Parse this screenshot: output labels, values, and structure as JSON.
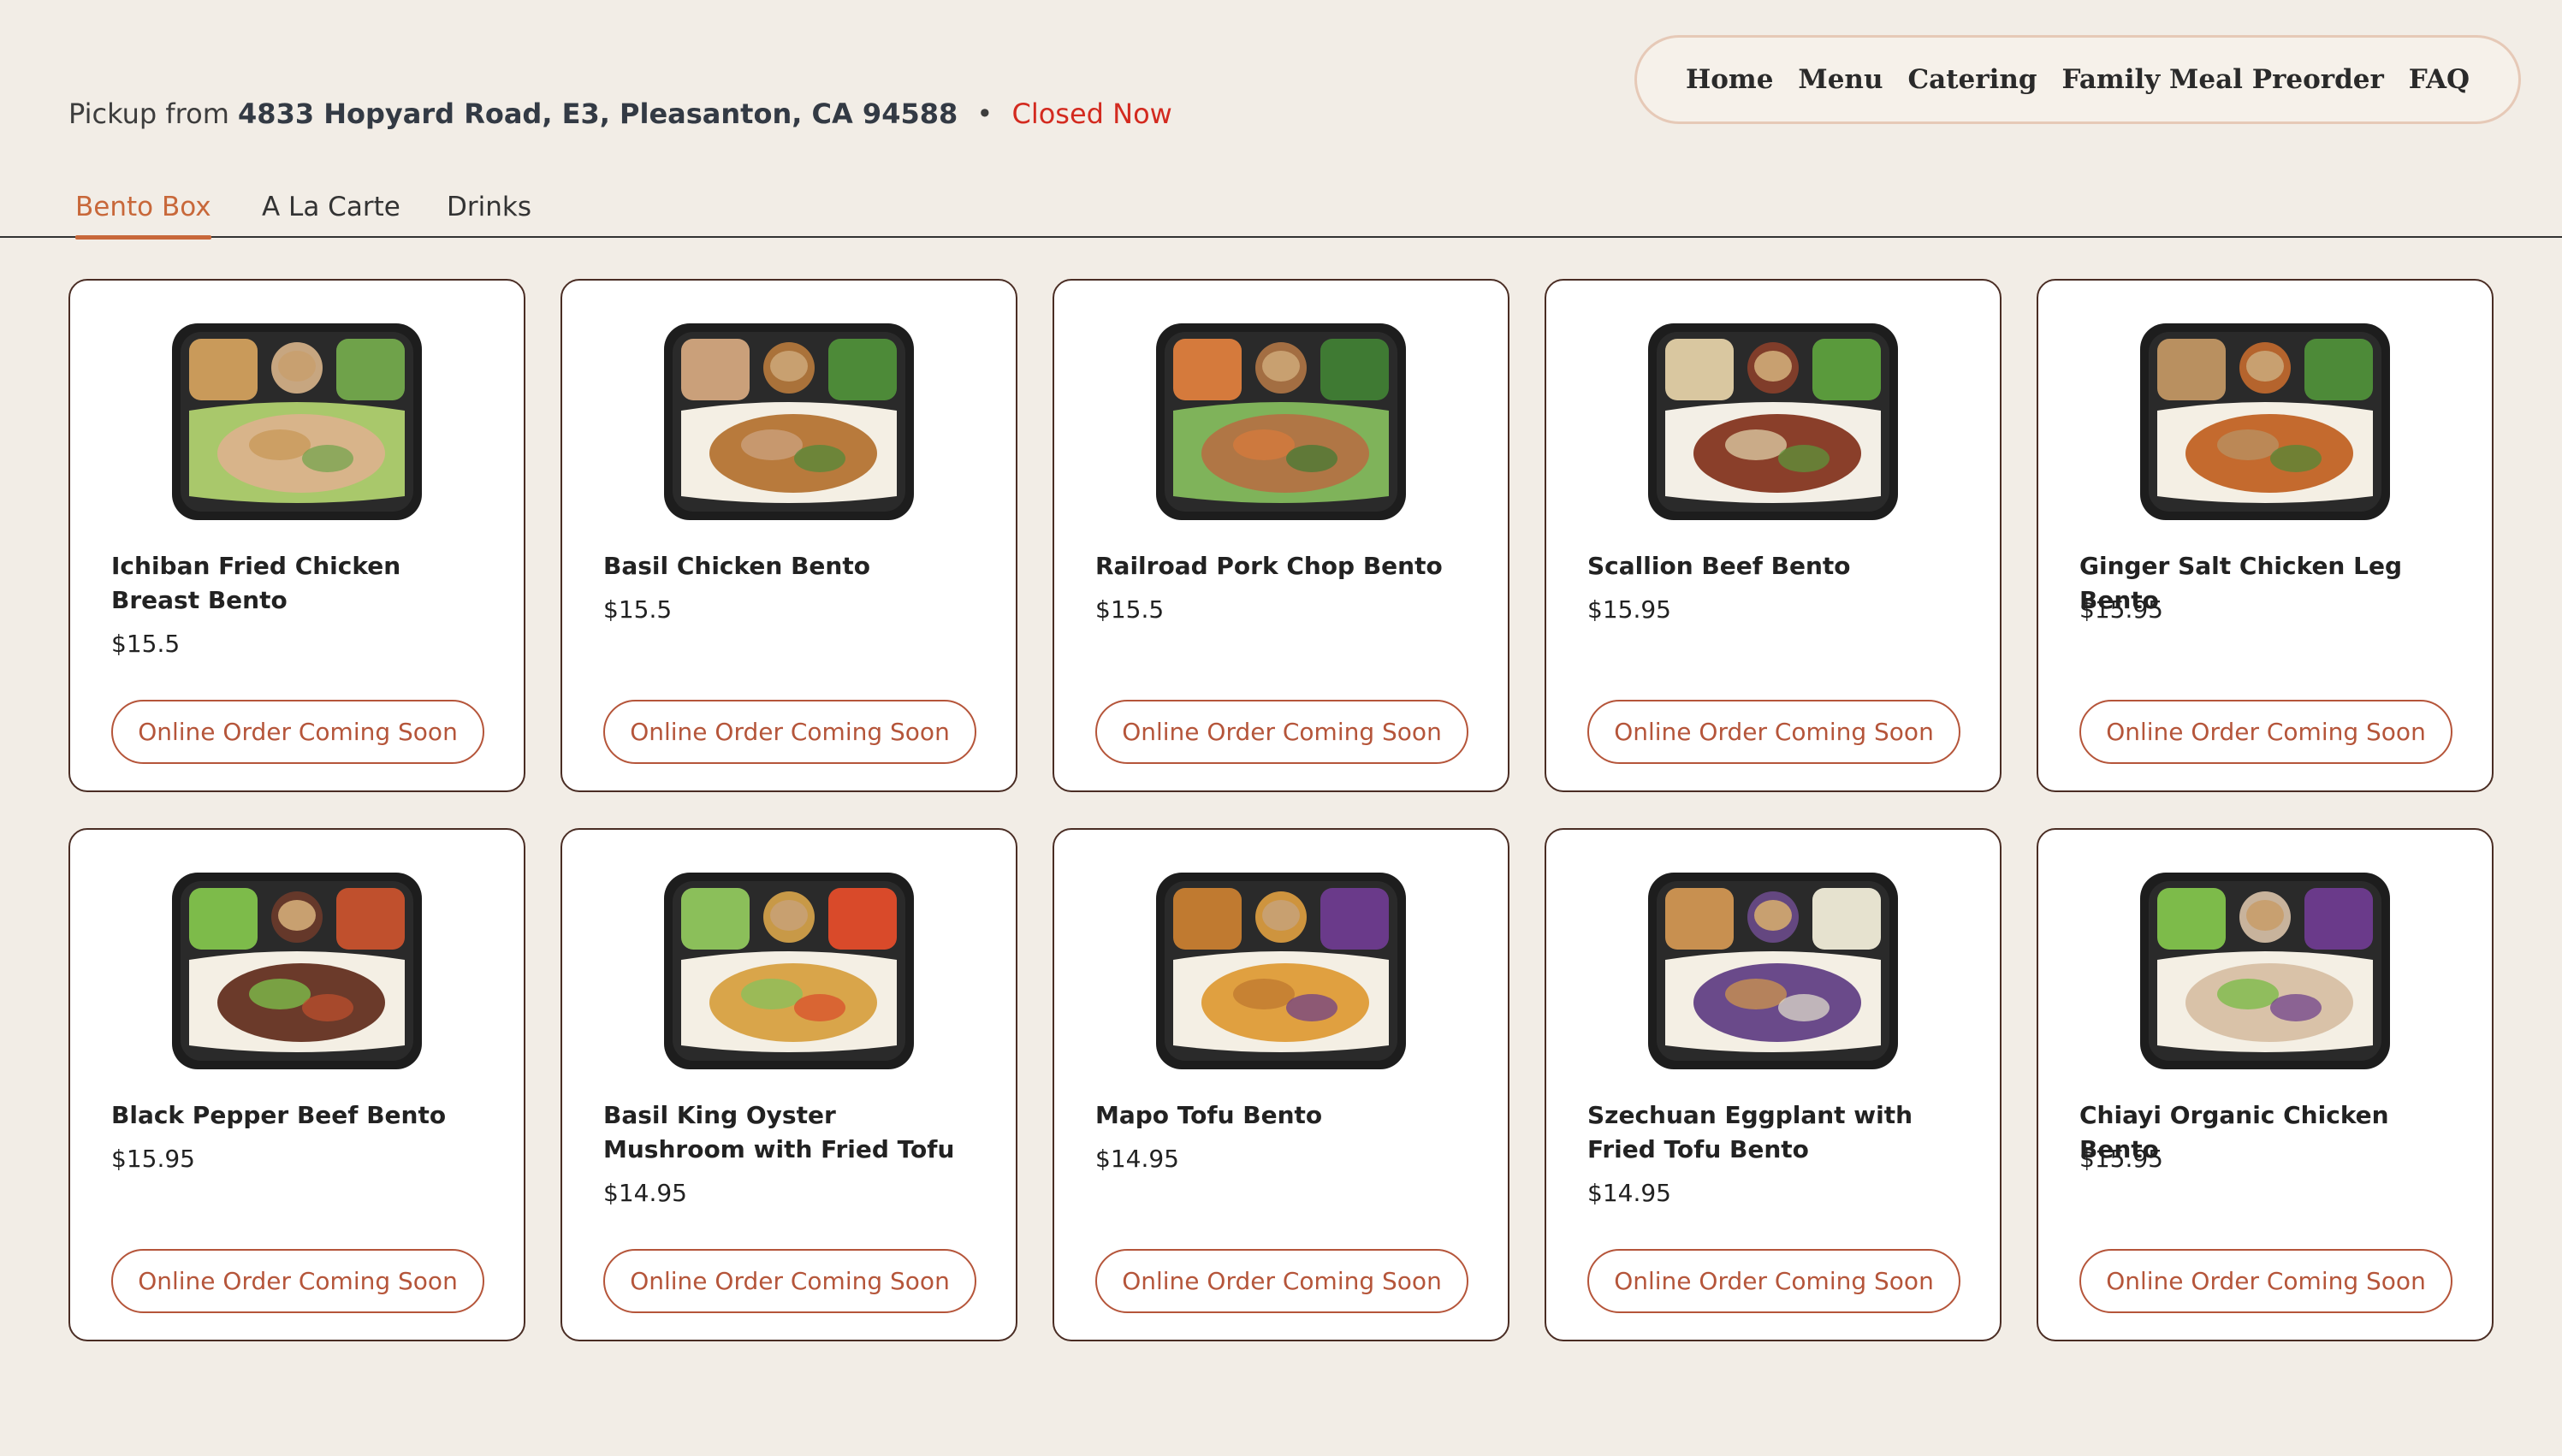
{
  "nav": {
    "items": [
      "Home",
      "Menu",
      "Catering",
      "Family Meal Preorder",
      "FAQ"
    ]
  },
  "pickup": {
    "prefix": "Pickup from",
    "address": "4833 Hopyard Road, E3, Pleasanton, CA 94588",
    "separator": "•",
    "status": "Closed Now"
  },
  "tabs": [
    "Bento Box",
    "A La Carte",
    "Drinks"
  ],
  "active_tab": "Bento Box",
  "button_label": "Online Order Coming Soon",
  "items": [
    {
      "name": "Ichiban Fried Chicken Breast Bento",
      "price": "$15.5",
      "title_lines": 2
    },
    {
      "name": "Basil Chicken Bento",
      "price": "$15.5",
      "title_lines": 1
    },
    {
      "name": "Railroad Pork Chop Bento",
      "price": "$15.5",
      "title_lines": 1
    },
    {
      "name": "Scallion Beef Bento",
      "price": "$15.95",
      "title_lines": 1
    },
    {
      "name": "Ginger Salt Chicken Leg Bento",
      "price": "$15.95",
      "title_lines": 1
    },
    {
      "name": "Black Pepper Beef Bento",
      "price": "$15.95",
      "title_lines": 1
    },
    {
      "name": "Basil King Oyster Mushroom with Fried Tofu",
      "price": "$14.95",
      "title_lines": 2
    },
    {
      "name": "Mapo Tofu Bento",
      "price": "$14.95",
      "title_lines": 1
    },
    {
      "name": "Szechuan Eggplant with Fried Tofu Bento",
      "price": "$14.95",
      "title_lines": 2
    },
    {
      "name": "Chiayi Organic Chicken Bento",
      "price": "$15.95",
      "title_lines": 1
    }
  ],
  "colors": {
    "background": "#f2ede6",
    "accent": "#c8683a",
    "button": "#b5553a",
    "status": "#d32a1f",
    "card_border": "#4a2d24"
  }
}
